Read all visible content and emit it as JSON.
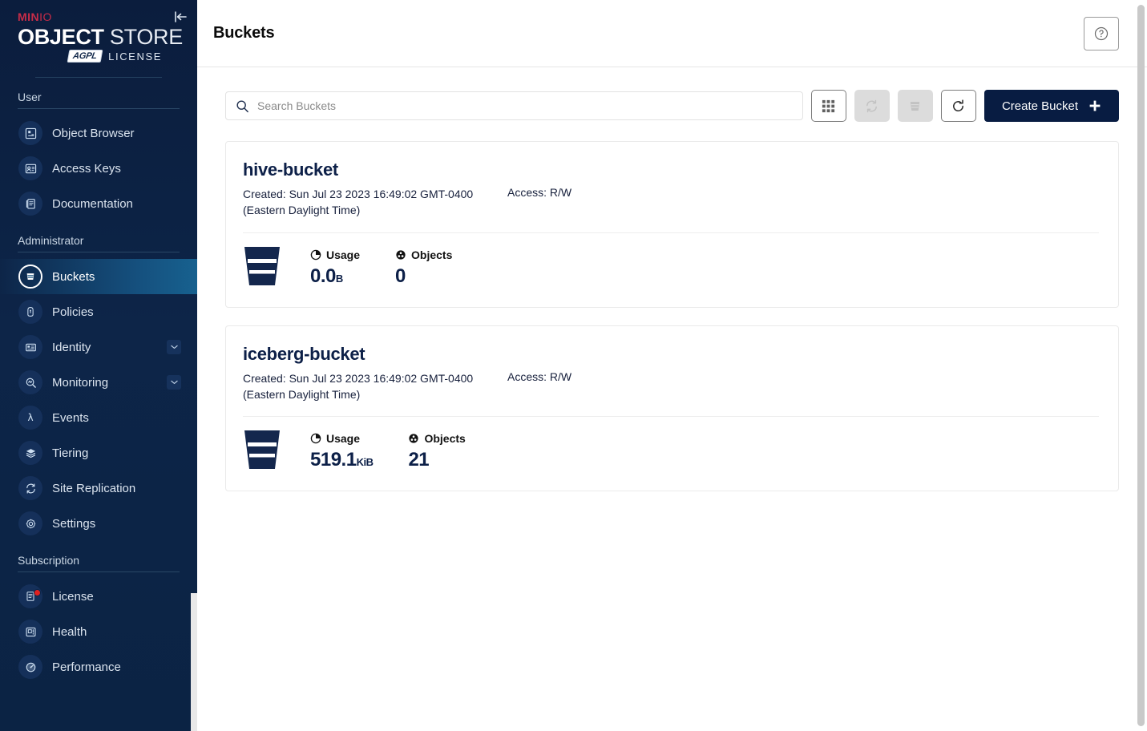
{
  "sidebar": {
    "logo": {
      "brand_prefix": "MIN",
      "brand_suffix": "IO",
      "title_bold": "OBJECT",
      "title_thin": " STORE",
      "badge": "AGPL",
      "license_label": "LICENSE"
    },
    "collapse_icon": "collapse-left-icon",
    "sections": [
      {
        "title": "User",
        "items": [
          {
            "label": "Object Browser",
            "icon": "object-browser-icon",
            "active": false
          },
          {
            "label": "Access Keys",
            "icon": "access-keys-icon",
            "active": false
          },
          {
            "label": "Documentation",
            "icon": "documentation-icon",
            "active": false
          }
        ]
      },
      {
        "title": "Administrator",
        "items": [
          {
            "label": "Buckets",
            "icon": "bucket-icon",
            "active": true
          },
          {
            "label": "Policies",
            "icon": "lock-icon",
            "active": false
          },
          {
            "label": "Identity",
            "icon": "identity-icon",
            "active": false,
            "expandable": true
          },
          {
            "label": "Monitoring",
            "icon": "monitoring-icon",
            "active": false,
            "expandable": true
          },
          {
            "label": "Events",
            "icon": "lambda-icon",
            "active": false
          },
          {
            "label": "Tiering",
            "icon": "layers-icon",
            "active": false
          },
          {
            "label": "Site Replication",
            "icon": "replication-icon",
            "active": false
          },
          {
            "label": "Settings",
            "icon": "gear-icon",
            "active": false
          }
        ]
      },
      {
        "title": "Subscription",
        "items": [
          {
            "label": "License",
            "icon": "license-icon",
            "active": false,
            "badge": true
          },
          {
            "label": "Health",
            "icon": "health-icon",
            "active": false
          },
          {
            "label": "Performance",
            "icon": "performance-icon",
            "active": false
          }
        ]
      }
    ]
  },
  "header": {
    "title": "Buckets",
    "help_icon": "help-circle-icon"
  },
  "toolbar": {
    "search_placeholder": "Search Buckets",
    "search_value": "",
    "search_icon": "search-icon",
    "buttons": [
      {
        "name": "grid-view-button",
        "icon": "grid-icon",
        "disabled": false
      },
      {
        "name": "replication-button",
        "icon": "sync-icon",
        "disabled": true
      },
      {
        "name": "delete-buckets-button",
        "icon": "delete-bucket-icon",
        "disabled": true
      },
      {
        "name": "refresh-button",
        "icon": "refresh-icon",
        "disabled": false
      }
    ],
    "create_label": "Create Bucket",
    "create_icon": "plus-icon"
  },
  "labels": {
    "created_prefix": "Created: ",
    "access_prefix": "Access: ",
    "usage": "Usage",
    "objects": "Objects"
  },
  "buckets": [
    {
      "name": "hive-bucket",
      "created": "Sun Jul 23 2023 16:49:02 GMT-0400 (Eastern Daylight Time)",
      "created_full": "Created: Sun Jul 23 2023 16:49:02 GMT-0400 (Eastern Daylight Time)",
      "access": "Access: R/W",
      "usage_value": "0.0",
      "usage_unit": "B",
      "objects": "0"
    },
    {
      "name": "iceberg-bucket",
      "created": "Sun Jul 23 2023 16:49:02 GMT-0400 (Eastern Daylight Time)",
      "created_full": "Created: Sun Jul 23 2023 16:49:02 GMT-0400 (Eastern Daylight Time)",
      "access": "Access: R/W",
      "usage_value": "519.1",
      "usage_unit": "KiB",
      "objects": "21"
    }
  ],
  "colors": {
    "sidebar_bg": "#0d2548",
    "sidebar_active": "#17618f",
    "brand_red": "#c72c48",
    "accent_navy": "#081c42",
    "badge_red": "#e02020"
  }
}
